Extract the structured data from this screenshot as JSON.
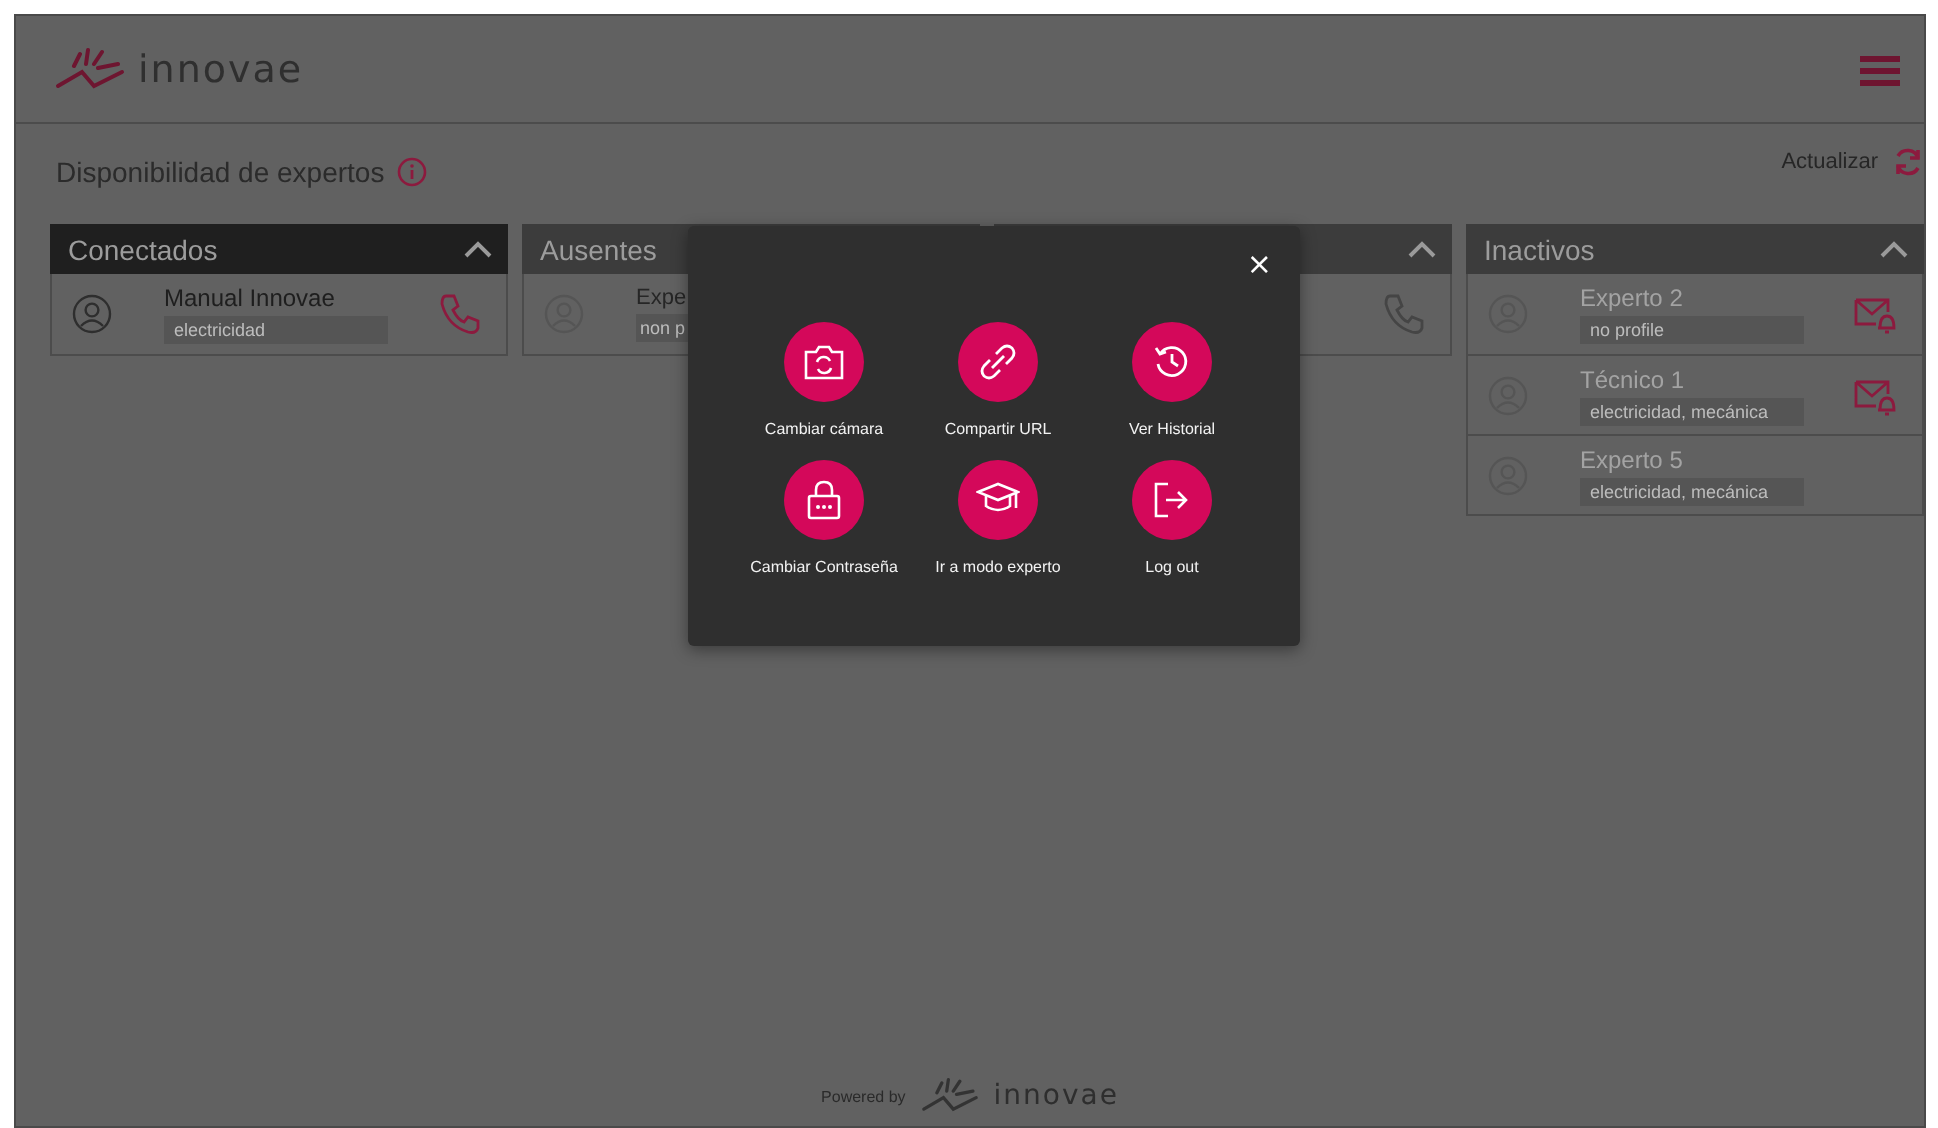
{
  "header": {
    "logo_text": "innovae"
  },
  "section": {
    "title": "Disponibilidad de expertos",
    "refresh_label": "Actualizar"
  },
  "columns": [
    {
      "title": "Conectados",
      "kind": "connected",
      "selected": true,
      "rows": [
        {
          "name": "Manual Innovae",
          "tag": "electricidad",
          "kind": "call"
        }
      ]
    },
    {
      "title": "Ausentes",
      "kind": "away",
      "selected": false,
      "rows": [
        {
          "name": "Expe",
          "tag": "non p",
          "kind": "plain"
        }
      ]
    },
    {
      "kind": "away",
      "selected": false,
      "rows": [
        {
          "kind": "call"
        }
      ]
    },
    {
      "title": "Inactivos",
      "kind": "inactive",
      "selected": false,
      "rows": [
        {
          "name": "Experto 2",
          "tag": "no profile",
          "kind": "notify"
        },
        {
          "name": "Técnico 1",
          "tag": "electricidad, mecánica",
          "kind": "notify"
        },
        {
          "name": "Experto 5",
          "tag": "electricidad, mecánica",
          "kind": "plain"
        }
      ]
    }
  ],
  "modal": {
    "close": "×",
    "actions": [
      {
        "label": "Cambiar cámara"
      },
      {
        "label": "Compartir URL"
      },
      {
        "label": "Ver Historial"
      },
      {
        "label": "Cambiar Contraseña"
      },
      {
        "label": "Ir a modo experto"
      },
      {
        "label": "Log out"
      }
    ]
  },
  "footer": {
    "powered_by": "Powered by",
    "logo_text": "innovae"
  }
}
